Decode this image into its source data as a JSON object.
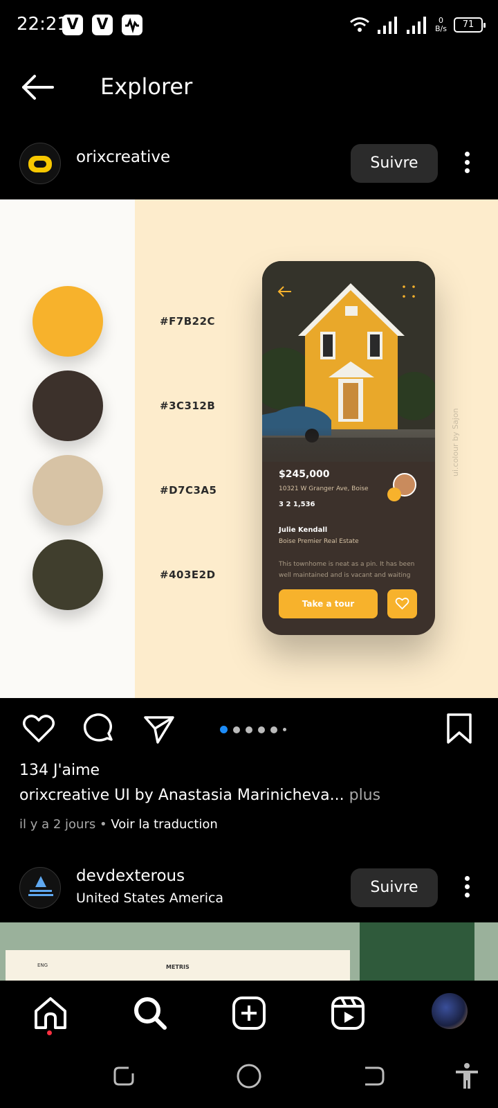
{
  "status_bar": {
    "time": "22:21",
    "app_icons": [
      "V",
      "V"
    ],
    "net_speed_value": "0",
    "net_speed_unit": "B/s",
    "battery": "71"
  },
  "header": {
    "title": "Explorer"
  },
  "post1": {
    "username": "orixcreative",
    "follow_label": "Suivre",
    "palette": [
      {
        "hex": "#F7B22C",
        "color": "#f7b22c"
      },
      {
        "hex": "#3C312B",
        "color": "#3c312b"
      },
      {
        "hex": "#D7C3A5",
        "color": "#d7c3a5"
      },
      {
        "hex": "#403E2D",
        "color": "#403e2d"
      }
    ],
    "mockup": {
      "price": "$245,000",
      "address": "10321 W Granger Ave, Boise",
      "specs": "3   2   1,536",
      "agent_name": "Julie Kendall",
      "agent_company": "Boise Premier Real Estate",
      "description": "This townhome is neat as a pin. It has been well maintained and is vacant and waiting",
      "cta": "Take a tour",
      "watermark": "ui.colour by Sajon"
    },
    "likes": "134 J'aime",
    "caption_user": "orixcreative",
    "caption_text": "UI by Anastasia Marinicheva...",
    "caption_more": "plus",
    "time_ago": "il y a 2 jours",
    "translate": "Voir la traduction",
    "carousel": {
      "count": 6,
      "active": 0
    }
  },
  "post2": {
    "username": "devdexterous",
    "location": "United States America",
    "follow_label": "Suivre",
    "preview_brand": "METRIS",
    "preview_lang": "ENG"
  },
  "colors": {
    "background": "#000000",
    "follow_bg": "#2b2b2b",
    "accent_blue": "#1d8cf8",
    "notification_red": "#ff3040"
  }
}
